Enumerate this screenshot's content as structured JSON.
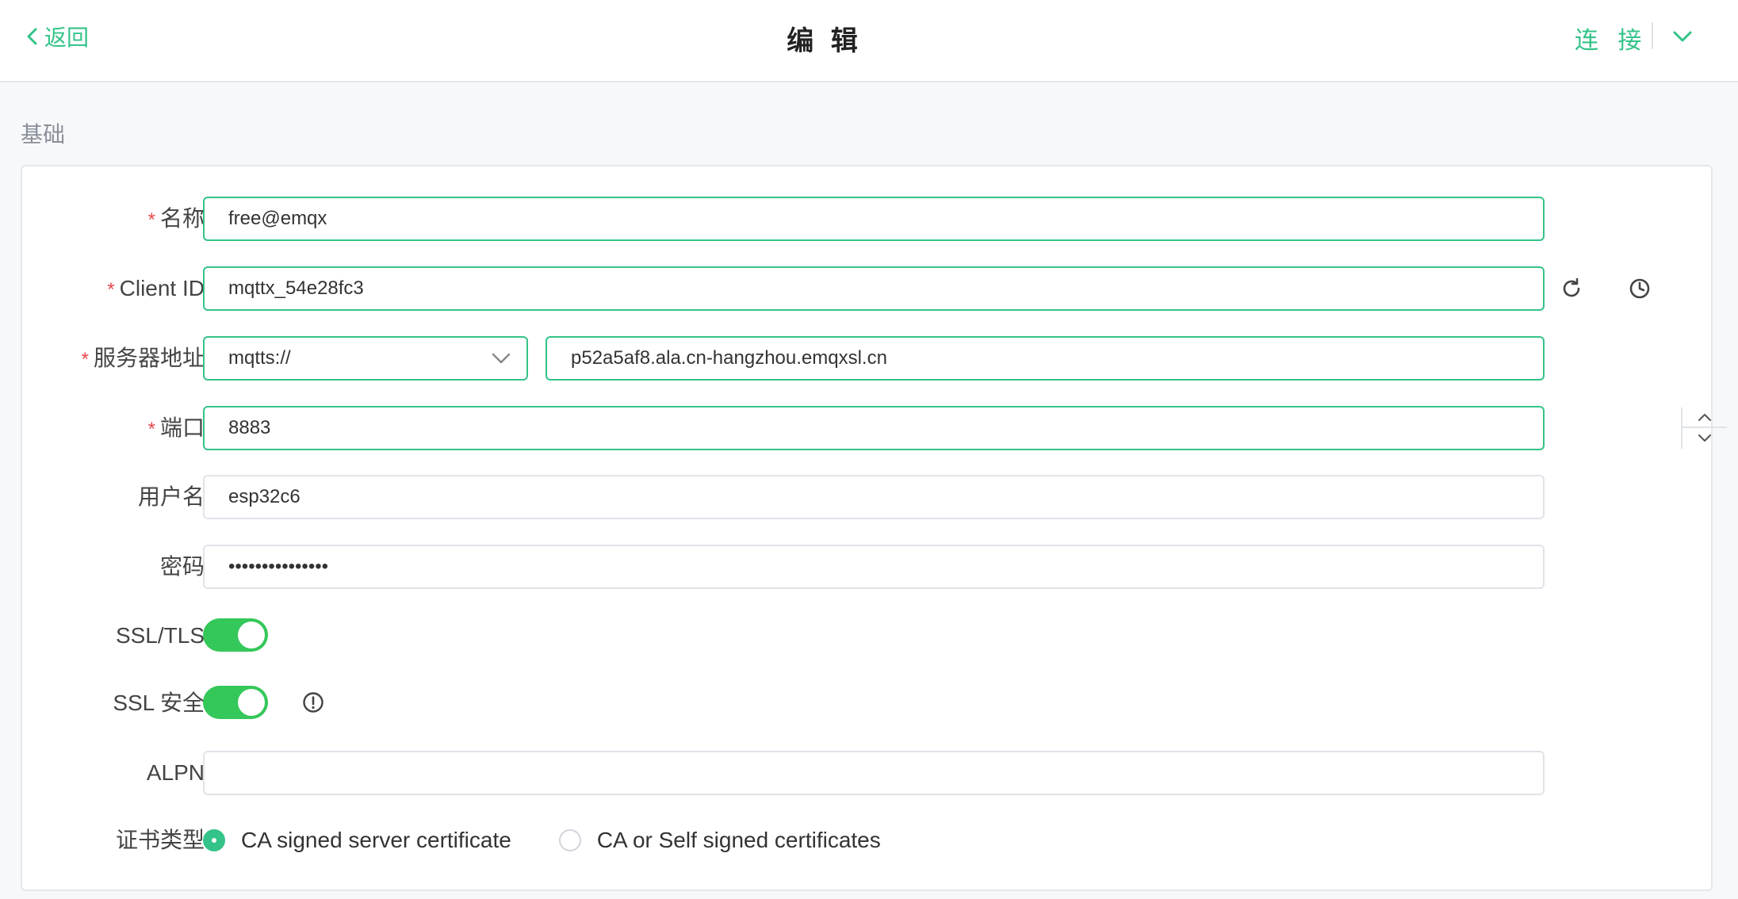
{
  "header": {
    "back_label": "返回",
    "title": "编 辑",
    "connect_label": "连 接"
  },
  "section": {
    "title": "基础"
  },
  "form": {
    "required_mark": "*",
    "name": {
      "label": "名称",
      "value": "free@emqx"
    },
    "client_id": {
      "label": "Client ID",
      "value": "mqttx_54e28fc3"
    },
    "server": {
      "label": "服务器地址",
      "protocol": "mqtts://",
      "host": "p52a5af8.ala.cn-hangzhou.emqxsl.cn"
    },
    "port": {
      "label": "端口",
      "value": "8883"
    },
    "username": {
      "label": "用户名",
      "value": "esp32c6"
    },
    "password": {
      "label": "密码",
      "value": "•••••••••••••••"
    },
    "ssl_tls": {
      "label": "SSL/TLS",
      "enabled": true
    },
    "ssl_secure": {
      "label": "SSL 安全",
      "enabled": true
    },
    "alpn": {
      "label": "ALPN",
      "value": ""
    },
    "cert_type": {
      "label": "证书类型",
      "options": [
        "CA signed server certificate",
        "CA or Self signed certificates"
      ],
      "selected": "CA signed server certificate"
    }
  },
  "colors": {
    "accent": "#34c388",
    "toggle_on": "#34c759",
    "required": "#e5484d"
  },
  "icons": [
    "chevron-left-icon",
    "chevron-down-icon",
    "refresh-icon",
    "clock-icon",
    "chevron-up-icon",
    "info-icon"
  ]
}
